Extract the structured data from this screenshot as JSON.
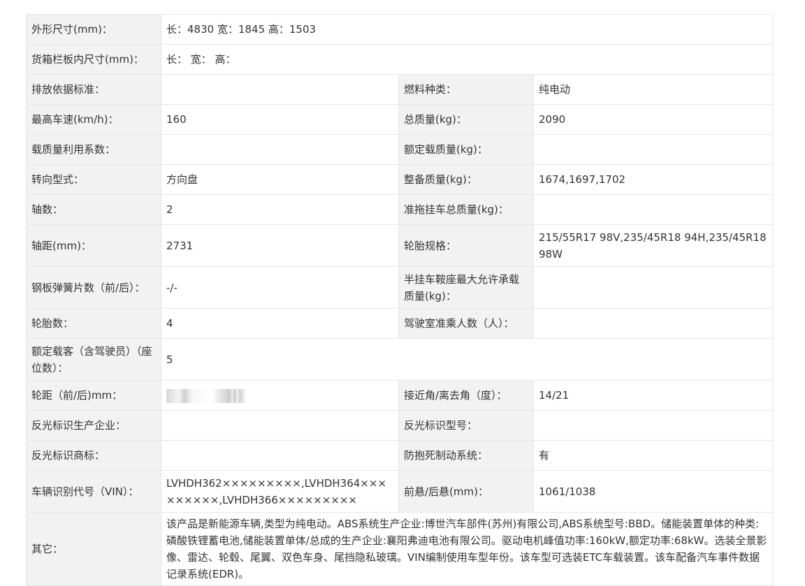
{
  "rows": [
    {
      "l1": "外形尺寸(mm)：",
      "v1": "长：4830 宽：1845 高：1503"
    },
    {
      "l1": "货箱栏板内尺寸(mm)：",
      "v1": "长：  宽：  高："
    },
    {
      "l1": "排放依据标准：",
      "v1": "",
      "l2": "燃料种类：",
      "v2": "纯电动"
    },
    {
      "l1": "最高车速(km/h)：",
      "v1": "160",
      "l2": "总质量(kg)：",
      "v2": "2090"
    },
    {
      "l1": "载质量利用系数：",
      "v1": "",
      "l2": "额定载质量(kg)：",
      "v2": ""
    },
    {
      "l1": "转向型式：",
      "v1": "方向盘",
      "l2": "整备质量(kg)：",
      "v2": "1674,1697,1702"
    },
    {
      "l1": "轴数：",
      "v1": "2",
      "l2": "准拖挂车总质量(kg)：",
      "v2": ""
    },
    {
      "l1": "轴距(mm)：",
      "v1": "2731",
      "l2": "轮胎规格：",
      "v2": "215/55R17 98V,235/45R18 94H,235/45R18 98W"
    },
    {
      "l1": "钢板弹簧片数（前/后）：",
      "v1": "-/-",
      "l2": "半挂车鞍座最大允许承载质量(kg)：",
      "v2": ""
    },
    {
      "l1": "轮胎数：",
      "v1": "4",
      "l2": "驾驶室准乘人数（人）：",
      "v2": ""
    },
    {
      "l1": "额定载客（含驾驶员）（座位数）：",
      "v1": "5"
    },
    {
      "l1": "轮距（前/后)mm：",
      "v1": "",
      "l2": "接近角/离去角（度）：",
      "v2": "14/21"
    },
    {
      "l1": "反光标识生产企业：",
      "v1": "",
      "l2": "反光标识型号：",
      "v2": ""
    },
    {
      "l1": "反光标识商标：",
      "v1": "",
      "l2": "防抱死制动系统：",
      "v2": "有"
    },
    {
      "l1": "车辆识别代号（VIN）：",
      "v1": "LVHDH362×××××××××,LVHDH364×××××××××,LVHDH366×××××××××",
      "l2": "前悬/后悬(mm)：",
      "v2": "1061/1038"
    },
    {
      "l1": "其它：",
      "v1": "该产品是新能源车辆,类型为纯电动。ABS系统生产企业:博世汽车部件(苏州)有限公司,ABS系统型号:BBD。储能装置单体的种类:磷酸铁锂蓄电池,储能装置单体/总成的生产企业:襄阳弗迪电池有限公司。驱动电机峰值功率:160kW,额定功率:68kW。选装全景影像、雷达、轮毂、尾翼、双色车身、尾挡隐私玻璃。VIN编制使用车型年份。该车型可选装ETC车载装置。该车配备汽车事件数据记录系统(EDR)。"
    }
  ]
}
